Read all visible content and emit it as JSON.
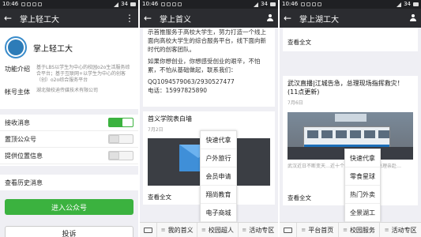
{
  "status_left": {
    "time": "10:46"
  },
  "panels": [
    {
      "status": {
        "time": "10:46",
        "signal": "34"
      },
      "title": "掌上轻工大",
      "account_name": "掌上轻工大",
      "info": [
        {
          "label": "功能介绍",
          "value": "基于LBS以学生为中心的校园o2o生活服务综合平台；基于互联网+以学生为中心的创客（创）o2o综合服务平台"
        },
        {
          "label": "帐号主体",
          "value": "湖北微校迪传媒技术有限公司"
        }
      ],
      "toggles": [
        {
          "label": "接收消息",
          "state": "on"
        },
        {
          "label": "置顶公众号",
          "state": "off"
        },
        {
          "label": "提供位置信息",
          "state": "off"
        }
      ],
      "history_label": "查看历史消息",
      "enter_button": "进入公众号",
      "complain_button": "投诉"
    },
    {
      "status": {
        "time": "10:46",
        "signal": "34"
      },
      "title": "掌上首义",
      "msg_lines": [
        "示首推服务于高校大学生，努力打造一个线上面向高校大学生的综合服务平台，线下面向新时代的创客团队。",
        "如果你想创业，你想感受创业的艰辛，不怕累，不怕从基础做起，联系我们：",
        "QQ1094579063/2930527477",
        "电话：15997825890"
      ],
      "card_title": "首义学院表白墙",
      "card_date": "7月2日",
      "cover_word": "言",
      "cover_sub": "ssage",
      "read_all": "查看全文",
      "popup": [
        "快速代拿",
        "户外旅行",
        "会员申请",
        "翔尚教育",
        "电子商城"
      ],
      "menu": [
        "我的首义",
        "校园超人",
        "活动专区"
      ]
    },
    {
      "status": {
        "time": "10:46",
        "signal": "34"
      },
      "title": "掌上湖工大",
      "read_all_top": "查看全文",
      "news_title": "武汉直播|江城告急，总理现场指挥救灾！(11点更新)",
      "news_date": "7月6日",
      "news_snippet": "武汉近日不断变天…近十个个论陷，季克强总理亲赴…",
      "read_all": "查看全文",
      "popup": [
        "快速代拿",
        "零食星球",
        "热门外卖",
        "全景湖工"
      ],
      "menu": [
        "平台首页",
        "校园服务",
        "活动专区"
      ]
    }
  ],
  "icons": [
    "back-arrow-icon",
    "person-icon",
    "keyboard-icon",
    "menu-bars-icon"
  ],
  "colors": {
    "accent_green": "#3bb23f",
    "titlebar": "#2b2c30",
    "statusbar": "#1f2023"
  }
}
